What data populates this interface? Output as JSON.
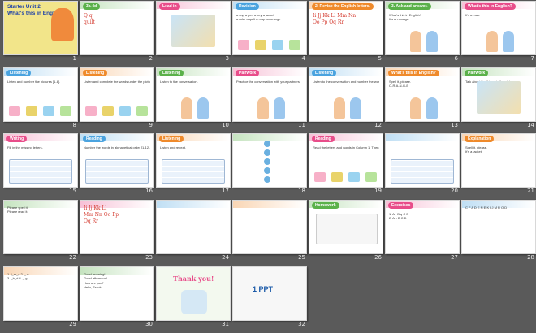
{
  "colors": {
    "background": "#5a5a5a",
    "thumb_border": "#d8d8d8",
    "slide_number": "#e8e8e8",
    "cover_bg": "#f2e58a",
    "title_blue": "#1b3fa8",
    "accent_orange": "#ef8a2b",
    "accent_green": "#5bb14a",
    "accent_pink": "#e84d8a",
    "letter_red": "#d43a2f"
  },
  "slides": [
    {
      "number": "1",
      "title": "Starter Unit 2\nWhat's this in English?",
      "lines": [],
      "theme": "cover"
    },
    {
      "number": "2",
      "title": "3a-4d",
      "lines": [
        "Q q",
        "quilt"
      ],
      "theme": "letters"
    },
    {
      "number": "3",
      "title": "Lead in",
      "lines": [],
      "theme": "photo"
    },
    {
      "number": "4",
      "title": "Revision",
      "lines": [
        "a cup  a pen  a key  a jacket",
        "a ruler  a quilt  a map  an orange"
      ],
      "theme": "list"
    },
    {
      "number": "5",
      "title": "2. Revise the English letters.",
      "lines": [
        "Ii Jj Kk Ll Mm Nn",
        "Oo Pp Qq Rr"
      ],
      "theme": "letters"
    },
    {
      "number": "6",
      "title": "3. Ask and answer.",
      "lines": [
        "What's this in English?",
        "It's an orange."
      ],
      "theme": "dialog"
    },
    {
      "number": "7",
      "title": "What's this in English?",
      "lines": [
        "It's a map."
      ],
      "theme": "dialog"
    },
    {
      "number": "8",
      "title": "Listening",
      "lines": [
        "Listen and number the pictures [1-8]."
      ],
      "theme": "grid"
    },
    {
      "number": "9",
      "title": "Listening",
      "lines": [
        "Listen and complete the words under the pictures in 1a."
      ],
      "theme": "grid"
    },
    {
      "number": "10",
      "title": "Listening",
      "lines": [
        "Listen to the conversation."
      ],
      "theme": "dialog"
    },
    {
      "number": "11",
      "title": "Pairwork",
      "lines": [
        "Practice the conversation with your partners."
      ],
      "theme": "dialog"
    },
    {
      "number": "12",
      "title": "Listening",
      "lines": [
        "Listen to the conversation and number the words you hear [1-4]."
      ],
      "theme": "dialog"
    },
    {
      "number": "13",
      "title": "What's this in English?",
      "lines": [
        "Spell it, please.",
        "O-R-A-N-G-E"
      ],
      "theme": "dialog"
    },
    {
      "number": "14",
      "title": "Pairwork",
      "lines": [
        "Talk about the things in the picture."
      ],
      "theme": "photo"
    },
    {
      "number": "15",
      "title": "Writing",
      "lines": [
        "Fill in the missing letters."
      ],
      "theme": "table"
    },
    {
      "number": "16",
      "title": "Reading",
      "lines": [
        "Number the words in alphabetical order [1-12]."
      ],
      "theme": "table"
    },
    {
      "number": "17",
      "title": "Listening",
      "lines": [
        "Listen and repeat."
      ],
      "theme": "table"
    },
    {
      "number": "18",
      "title": "",
      "lines": [],
      "theme": "match"
    },
    {
      "number": "19",
      "title": "Reading",
      "lines": [
        "Read the letters and words in Column 1. Then try to read the new words in column 2."
      ],
      "theme": "list"
    },
    {
      "number": "20",
      "title": "",
      "lines": [],
      "theme": "table"
    },
    {
      "number": "21",
      "title": "Explanation",
      "lines": [
        "Spell it, please.",
        "It's a jacket."
      ],
      "theme": "notes"
    },
    {
      "number": "22",
      "title": "",
      "lines": [
        "Please spell it.",
        "Please read it."
      ],
      "theme": "notes"
    },
    {
      "number": "23",
      "title": "",
      "lines": [
        "Ii Jj Kk Ll",
        "Mm Nn Oo Pp",
        "Qq Rr"
      ],
      "theme": "letters"
    },
    {
      "number": "24",
      "title": "",
      "lines": [],
      "theme": "notes"
    },
    {
      "number": "25",
      "title": "",
      "lines": [],
      "theme": "notes"
    },
    {
      "number": "26",
      "title": "Homework",
      "lines": [],
      "theme": "homework"
    },
    {
      "number": "27",
      "title": "Exercises",
      "lines": [
        "1. A r  B q  C  D",
        "2. A x  B  C  D"
      ],
      "theme": "exercise"
    },
    {
      "number": "28",
      "title": "",
      "lines": [
        "C F A D E N E K I J M R O D"
      ],
      "theme": "exercise"
    },
    {
      "number": "29",
      "title": "",
      "lines": [
        "1. I_m_c  2. _ n",
        "3. _b_d  4. _ g"
      ],
      "theme": "exercise"
    },
    {
      "number": "30",
      "title": "",
      "lines": [
        "Good morning!",
        "Good afternoon!",
        "How are you?",
        "Hello, Frank."
      ],
      "theme": "exercise"
    },
    {
      "number": "31",
      "title": "Thank you!",
      "lines": [],
      "theme": "thanks"
    },
    {
      "number": "32",
      "title": "1 PPT",
      "lines": [],
      "theme": "ppt"
    }
  ]
}
